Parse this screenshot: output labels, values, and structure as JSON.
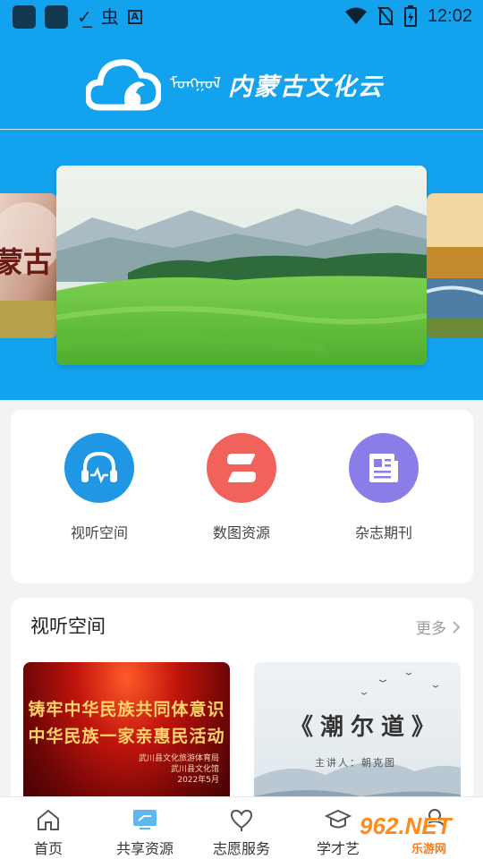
{
  "status_bar": {
    "time": "12:02",
    "icons": [
      "app-icon",
      "app-icon",
      "checklist-icon",
      "bug-icon",
      "a-icon",
      "wifi-icon",
      "no-sim-icon",
      "battery-icon"
    ]
  },
  "header": {
    "logo_text": "内蒙古文化云",
    "logo_mongolian": "ᠮᠣᠩᠭᠣᠯ",
    "logo_icon": "cloud-horse-logo-icon"
  },
  "banner": {
    "left_card_text": "蒙古",
    "slides": [
      "grassland-landscape",
      "river-landscape"
    ]
  },
  "quick_menu": {
    "items": [
      {
        "label": "视听空间",
        "icon": "headphones-icon",
        "color": "#1f97e4"
      },
      {
        "label": "数图资源",
        "icon": "book-s-icon",
        "color": "#f0625a"
      },
      {
        "label": "杂志期刊",
        "icon": "newspaper-icon",
        "color": "#8a7de8"
      }
    ]
  },
  "section": {
    "title": "视听空间",
    "more": "更多",
    "thumbs": [
      {
        "line1": "铸牢中华民族共同体意识",
        "line2": "中华民族一家亲惠民活动",
        "org1": "武川县文化旅游体育局",
        "org2": "武川县文化馆",
        "date": "2022年5月"
      },
      {
        "title": "《潮尔道》",
        "sub": "主讲人：朝克图"
      }
    ]
  },
  "bottom_nav": {
    "items": [
      {
        "label": "首页",
        "icon": "home-icon"
      },
      {
        "label": "共享资源",
        "icon": "monitor-icon"
      },
      {
        "label": "志愿服务",
        "icon": "heart-icon"
      },
      {
        "label": "学才艺",
        "icon": "graduation-cap-icon"
      },
      {
        "label": "",
        "icon": "user-icon"
      }
    ]
  },
  "watermark": {
    "big": "962.NET",
    "small": "乐游网"
  },
  "colors": {
    "brand_blue": "#13a2ee",
    "background": "#f2f3f5"
  }
}
